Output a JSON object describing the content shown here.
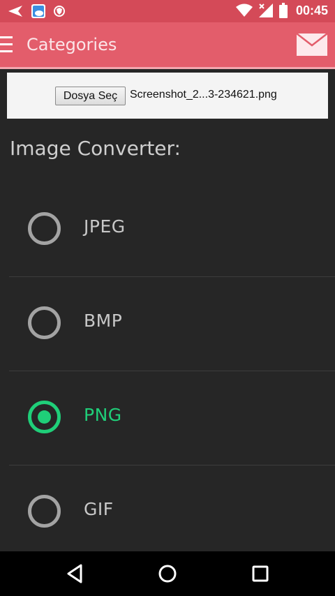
{
  "status_bar": {
    "time": "00:45",
    "icons": [
      "back-arrow-notification-icon",
      "weather-notification-icon",
      "shield-notification-icon",
      "wifi-icon",
      "signal-icon",
      "battery-icon"
    ]
  },
  "app_bar": {
    "title": "Categories",
    "menu_icon": "hamburger-menu-icon",
    "action_icon": "mail-icon"
  },
  "file_picker": {
    "button_label": "Dosya Seç",
    "file_name": "Screenshot_2...3-234621.png"
  },
  "converter": {
    "heading": "Image Converter:",
    "options": [
      {
        "label": "JPEG",
        "checked": false
      },
      {
        "label": "BMP",
        "checked": false
      },
      {
        "label": "PNG",
        "checked": true
      },
      {
        "label": "GIF",
        "checked": false
      }
    ]
  },
  "nav_bar": {
    "buttons": [
      "back-icon",
      "home-icon",
      "recents-icon"
    ]
  },
  "colors": {
    "status_bar": "#d44a58",
    "app_bar": "#e35d6b",
    "background": "#262626",
    "accent_checked": "#1fcf79",
    "radio_unchecked": "#a3a3a3"
  }
}
